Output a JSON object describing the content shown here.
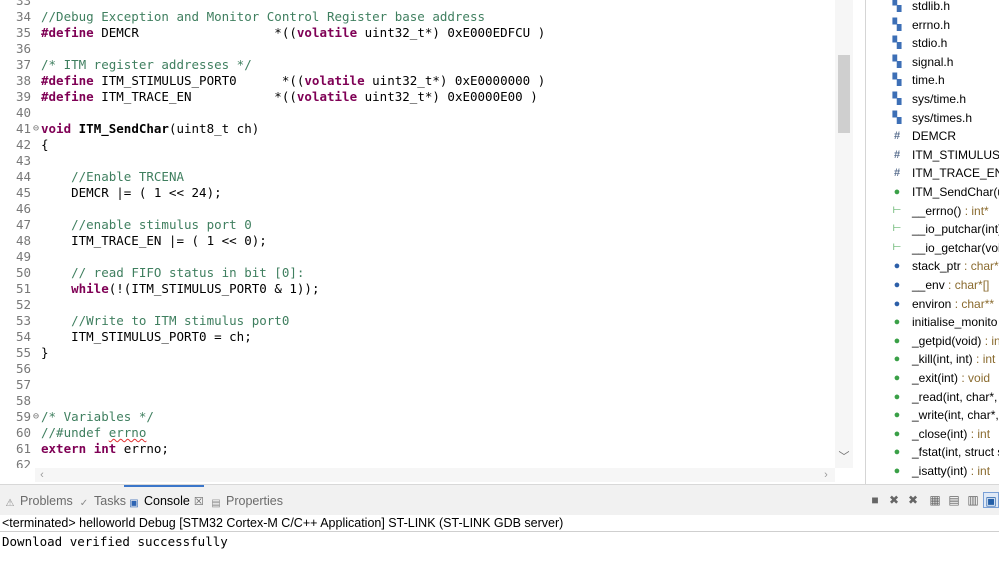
{
  "editor": {
    "lines": [
      {
        "n": "33",
        "fold": "",
        "tokens": []
      },
      {
        "n": "34",
        "fold": "",
        "tokens": [
          {
            "c": "cm",
            "t": "//Debug Exception and Monitor Control Register base address"
          }
        ]
      },
      {
        "n": "35",
        "fold": "",
        "tokens": [
          {
            "c": "kw",
            "t": "#define"
          },
          {
            "c": "",
            "t": " DEMCR                  *(("
          },
          {
            "c": "kw",
            "t": "volatile"
          },
          {
            "c": "",
            "t": " uint32_t*) 0xE000EDFCU )"
          }
        ]
      },
      {
        "n": "36",
        "fold": "",
        "tokens": []
      },
      {
        "n": "37",
        "fold": "",
        "tokens": [
          {
            "c": "cm",
            "t": "/* ITM register addresses */"
          }
        ]
      },
      {
        "n": "38",
        "fold": "",
        "tokens": [
          {
            "c": "kw",
            "t": "#define"
          },
          {
            "c": "",
            "t": " ITM_STIMULUS_PORT0      *(("
          },
          {
            "c": "kw",
            "t": "volatile"
          },
          {
            "c": "",
            "t": " uint32_t*) 0xE0000000 )"
          }
        ]
      },
      {
        "n": "39",
        "fold": "",
        "tokens": [
          {
            "c": "kw",
            "t": "#define"
          },
          {
            "c": "",
            "t": " ITM_TRACE_EN           *(("
          },
          {
            "c": "kw",
            "t": "volatile"
          },
          {
            "c": "",
            "t": " uint32_t*) 0xE0000E00 )"
          }
        ]
      },
      {
        "n": "40",
        "fold": "",
        "tokens": []
      },
      {
        "n": "41",
        "fold": "⊖",
        "tokens": [
          {
            "c": "kw",
            "t": "void"
          },
          {
            "c": "",
            "t": " "
          },
          {
            "c": "fn",
            "t": "ITM_SendChar"
          },
          {
            "c": "",
            "t": "(uint8_t ch)"
          }
        ]
      },
      {
        "n": "42",
        "fold": "",
        "tokens": [
          {
            "c": "",
            "t": "{"
          }
        ]
      },
      {
        "n": "43",
        "fold": "",
        "tokens": []
      },
      {
        "n": "44",
        "fold": "",
        "tokens": [
          {
            "c": "",
            "t": "    "
          },
          {
            "c": "cm",
            "t": "//Enable TRCENA"
          }
        ]
      },
      {
        "n": "45",
        "fold": "",
        "tokens": [
          {
            "c": "",
            "t": "    DEMCR |= ( 1 << 24);"
          }
        ]
      },
      {
        "n": "46",
        "fold": "",
        "tokens": []
      },
      {
        "n": "47",
        "fold": "",
        "tokens": [
          {
            "c": "",
            "t": "    "
          },
          {
            "c": "cm",
            "t": "//enable stimulus port 0"
          }
        ]
      },
      {
        "n": "48",
        "fold": "",
        "tokens": [
          {
            "c": "",
            "t": "    ITM_TRACE_EN |= ( 1 << 0);"
          }
        ]
      },
      {
        "n": "49",
        "fold": "",
        "tokens": []
      },
      {
        "n": "50",
        "fold": "",
        "tokens": [
          {
            "c": "",
            "t": "    "
          },
          {
            "c": "cm",
            "t": "// read FIFO status in bit [0]:"
          }
        ]
      },
      {
        "n": "51",
        "fold": "",
        "tokens": [
          {
            "c": "",
            "t": "    "
          },
          {
            "c": "kw",
            "t": "while"
          },
          {
            "c": "",
            "t": "(!(ITM_STIMULUS_PORT0 & 1));"
          }
        ]
      },
      {
        "n": "52",
        "fold": "",
        "tokens": []
      },
      {
        "n": "53",
        "fold": "",
        "tokens": [
          {
            "c": "",
            "t": "    "
          },
          {
            "c": "cm",
            "t": "//Write to ITM stimulus port0"
          }
        ]
      },
      {
        "n": "54",
        "fold": "",
        "tokens": [
          {
            "c": "",
            "t": "    ITM_STIMULUS_PORT0 = ch;"
          }
        ]
      },
      {
        "n": "55",
        "fold": "",
        "tokens": [
          {
            "c": "",
            "t": "}"
          }
        ]
      },
      {
        "n": "56",
        "fold": "",
        "tokens": []
      },
      {
        "n": "57",
        "fold": "",
        "tokens": []
      },
      {
        "n": "58",
        "fold": "",
        "tokens": []
      },
      {
        "n": "59",
        "fold": "⊖",
        "tokens": [
          {
            "c": "cm",
            "t": "/* Variables */"
          }
        ]
      },
      {
        "n": "60",
        "fold": "",
        "tokens": [
          {
            "c": "cm",
            "t": "//#undef "
          },
          {
            "c": "cm sq",
            "t": "errno"
          }
        ]
      },
      {
        "n": "61",
        "fold": "",
        "tokens": [
          {
            "c": "kw",
            "t": "extern"
          },
          {
            "c": "",
            "t": " "
          },
          {
            "c": "kw",
            "t": "int"
          },
          {
            "c": "",
            "t": " errno;"
          }
        ]
      },
      {
        "n": "62",
        "fold": "",
        "tokens": [
          {
            "c": "",
            "t": "                                                  "
          }
        ]
      }
    ]
  },
  "outline": {
    "items": [
      {
        "icon": "header-file-icon",
        "glyph": "▚",
        "cls": "ic-h",
        "name": "stdlib.h",
        "type": ""
      },
      {
        "icon": "header-file-icon",
        "glyph": "▚",
        "cls": "ic-h",
        "name": "errno.h",
        "type": ""
      },
      {
        "icon": "header-file-icon",
        "glyph": "▚",
        "cls": "ic-h",
        "name": "stdio.h",
        "type": ""
      },
      {
        "icon": "header-file-icon",
        "glyph": "▚",
        "cls": "ic-h",
        "name": "signal.h",
        "type": ""
      },
      {
        "icon": "header-file-icon",
        "glyph": "▚",
        "cls": "ic-h",
        "name": "time.h",
        "type": ""
      },
      {
        "icon": "header-file-icon",
        "glyph": "▚",
        "cls": "ic-h",
        "name": "sys/time.h",
        "type": ""
      },
      {
        "icon": "header-file-icon",
        "glyph": "▚",
        "cls": "ic-h",
        "name": "sys/times.h",
        "type": ""
      },
      {
        "icon": "macro-icon",
        "glyph": "#",
        "cls": "ic-hash",
        "name": "DEMCR",
        "type": ""
      },
      {
        "icon": "macro-icon",
        "glyph": "#",
        "cls": "ic-hash",
        "name": "ITM_STIMULUS_",
        "type": ""
      },
      {
        "icon": "macro-icon",
        "glyph": "#",
        "cls": "ic-hash",
        "name": "ITM_TRACE_EN",
        "type": ""
      },
      {
        "icon": "function-icon",
        "glyph": "●",
        "cls": "ic-dot",
        "name": "ITM_SendChar(u",
        "type": ""
      },
      {
        "icon": "function-prototype-icon",
        "glyph": "⊢",
        "cls": "ic-proto",
        "name": "__errno()",
        "type": " : int*"
      },
      {
        "icon": "function-prototype-icon",
        "glyph": "⊢",
        "cls": "ic-proto",
        "name": "__io_putchar(int)",
        "type": ""
      },
      {
        "icon": "function-prototype-icon",
        "glyph": "⊢",
        "cls": "ic-proto",
        "name": "__io_getchar(void",
        "type": ""
      },
      {
        "icon": "variable-icon",
        "glyph": "●",
        "cls": "ic-dot-blue",
        "name": "stack_ptr",
        "type": " : char*"
      },
      {
        "icon": "variable-icon",
        "glyph": "●",
        "cls": "ic-dot-blue",
        "name": "__env",
        "type": " : char*[]"
      },
      {
        "icon": "variable-icon",
        "glyph": "●",
        "cls": "ic-dot-blue",
        "name": "environ",
        "type": " : char**"
      },
      {
        "icon": "function-icon",
        "glyph": "●",
        "cls": "ic-dot",
        "name": "initialise_monito",
        "type": ""
      },
      {
        "icon": "function-icon",
        "glyph": "●",
        "cls": "ic-dot",
        "name": "_getpid(void)",
        "type": " : in"
      },
      {
        "icon": "function-icon",
        "glyph": "●",
        "cls": "ic-dot",
        "name": "_kill(int, int)",
        "type": " : int"
      },
      {
        "icon": "function-icon",
        "glyph": "●",
        "cls": "ic-dot",
        "name": "_exit(int)",
        "type": " : void"
      },
      {
        "icon": "function-icon",
        "glyph": "●",
        "cls": "ic-dot",
        "name": "_read(int, char*, i",
        "type": ""
      },
      {
        "icon": "function-icon",
        "glyph": "●",
        "cls": "ic-dot",
        "name": "_write(int, char*,",
        "type": ""
      },
      {
        "icon": "function-icon",
        "glyph": "●",
        "cls": "ic-dot",
        "name": "_close(int)",
        "type": " : int"
      },
      {
        "icon": "function-icon",
        "glyph": "●",
        "cls": "ic-dot",
        "name": "_fstat(int, struct s",
        "type": ""
      },
      {
        "icon": "function-icon",
        "glyph": "●",
        "cls": "ic-dot",
        "name": "_isatty(int)",
        "type": " : int"
      }
    ]
  },
  "panel": {
    "tabs": [
      {
        "label": "Problems",
        "icon": "problems-icon",
        "glyph": "⚠",
        "active": false
      },
      {
        "label": "Tasks",
        "icon": "tasks-icon",
        "glyph": "✓",
        "active": false
      },
      {
        "label": "Console",
        "icon": "console-icon",
        "glyph": "▣",
        "active": true
      },
      {
        "label": "Properties",
        "icon": "properties-icon",
        "glyph": "▤",
        "active": false
      }
    ],
    "close_glyph": "☒",
    "toolbar": [
      {
        "name": "stop-icon",
        "glyph": "■"
      },
      {
        "name": "remove-launch-icon",
        "glyph": "✖"
      },
      {
        "name": "remove-all-terminated-icon",
        "glyph": "✖"
      },
      {
        "name": "clear-console-icon",
        "glyph": "▦"
      },
      {
        "name": "scroll-lock-icon",
        "glyph": "▤"
      },
      {
        "name": "word-wrap-icon",
        "glyph": "▥"
      },
      {
        "name": "pin-console-icon",
        "glyph": "▧"
      },
      {
        "name": "display-selected-console-icon",
        "glyph": "▣"
      }
    ],
    "console_header": "<terminated> helloworld Debug [STM32 Cortex-M C/C++ Application] ST-LINK (ST-LINK GDB server)",
    "console_output": "Download verified successfully"
  }
}
